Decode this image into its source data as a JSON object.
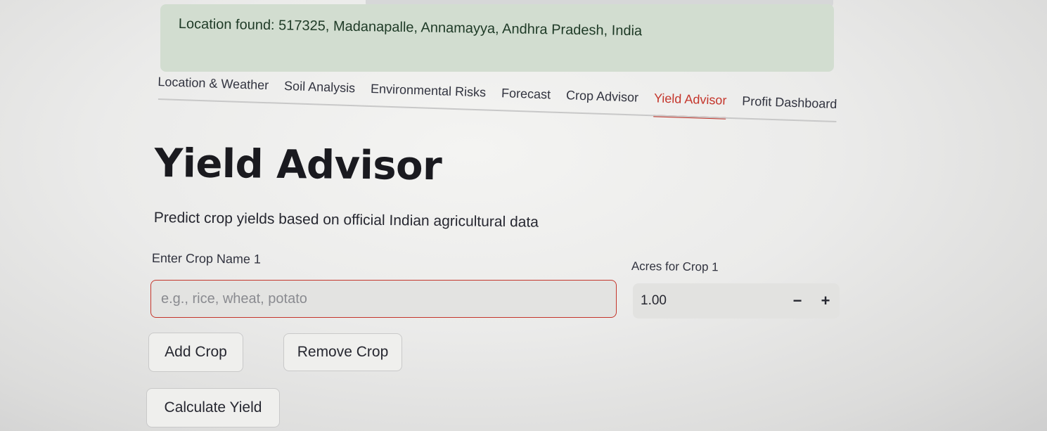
{
  "alert": {
    "text": "Location found: 517325, Madanapalle, Annamayya, Andhra Pradesh, India"
  },
  "tabs": [
    {
      "label": "Location & Weather",
      "active": false
    },
    {
      "label": "Soil Analysis",
      "active": false
    },
    {
      "label": "Environmental Risks",
      "active": false
    },
    {
      "label": "Forecast",
      "active": false
    },
    {
      "label": "Crop Advisor",
      "active": false
    },
    {
      "label": "Yield Advisor",
      "active": true
    },
    {
      "label": "Profit Dashboard",
      "active": false
    }
  ],
  "main": {
    "title": "Yield Advisor",
    "subtitle": "Predict crop yields based on official Indian agricultural data",
    "crop_field": {
      "label": "Enter Crop Name 1",
      "value": "",
      "placeholder": "e.g., rice, wheat, potato"
    },
    "acres_field": {
      "label": "Acres for Crop 1",
      "value": "1.00",
      "decrement_label": "−",
      "increment_label": "+"
    },
    "buttons": {
      "add_crop": "Add Crop",
      "remove_crop": "Remove Crop",
      "calculate_yield": "Calculate Yield"
    }
  },
  "colors": {
    "accent": "#c4352b",
    "success_bg": "#d2ddd0",
    "success_text": "#1e3a26"
  }
}
